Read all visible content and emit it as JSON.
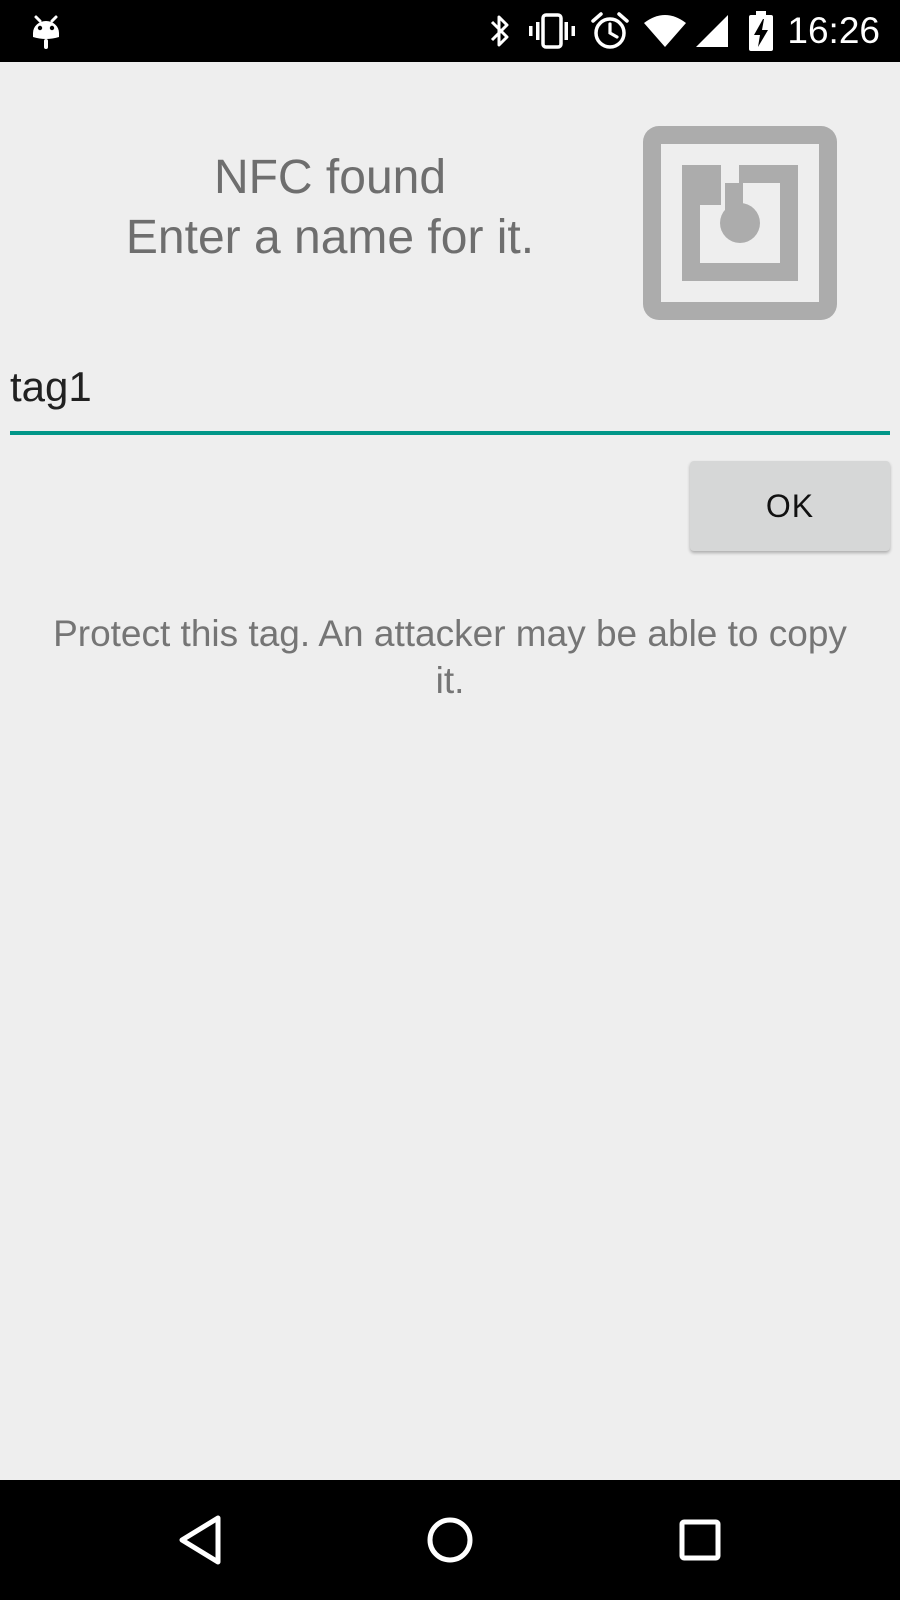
{
  "status_bar": {
    "time": "16:26",
    "icons": [
      "android-debug-icon",
      "bluetooth-icon",
      "vibrate-icon",
      "alarm-icon",
      "wifi-icon",
      "signal-icon",
      "battery-charging-icon"
    ]
  },
  "header": {
    "title_line1": "NFC found",
    "title_line2": "Enter a name for it.",
    "icon": "nfc-icon"
  },
  "name_input": {
    "value": "tag1"
  },
  "ok_button": {
    "label": "OK"
  },
  "warning": {
    "text": "Protect this tag. An attacker may be able to copy it."
  },
  "nav_bar": {
    "icons": [
      "back-icon",
      "home-icon",
      "recents-icon"
    ]
  },
  "colors": {
    "background": "#eeeeee",
    "accent": "#009688",
    "button": "#d6d7d7",
    "icon_gray": "#acacac",
    "text_gray": "#6e6e6e"
  }
}
